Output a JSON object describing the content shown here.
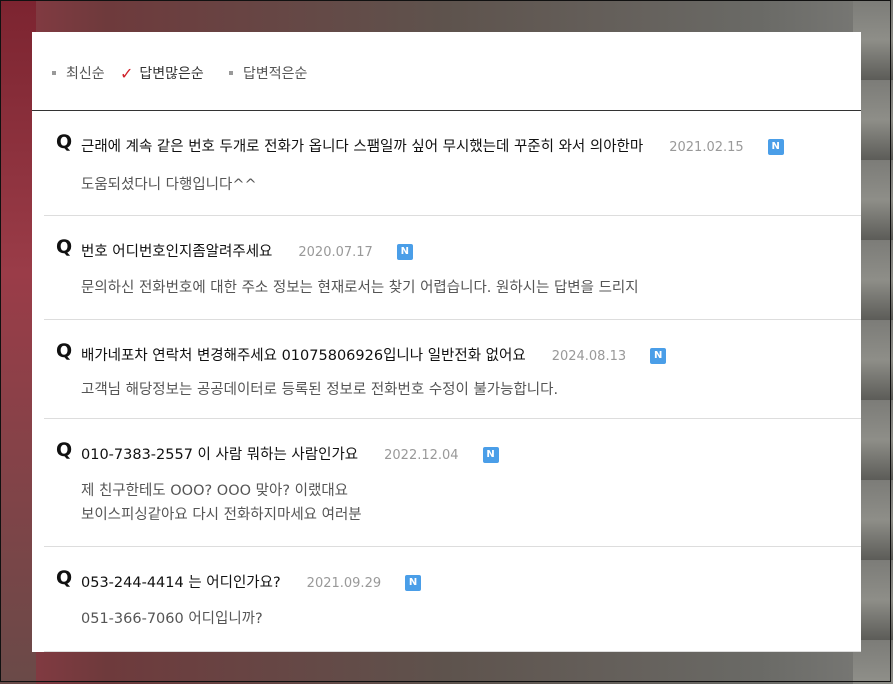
{
  "sort": {
    "items": [
      {
        "label": "최신순",
        "active": false
      },
      {
        "label": "답변많은순",
        "active": true
      },
      {
        "label": "답변적은순",
        "active": false
      }
    ]
  },
  "questions": [
    {
      "q": "Q",
      "title": "근래에 계속 같은 번호 두개로 전화가 옵니다 스팸일까 싶어 무시했는데 꾸준히 와서 의아한마",
      "date": "2021.02.15",
      "badge": "N",
      "answer": [
        "도움되셨다니 다행입니다^^"
      ]
    },
    {
      "q": "Q",
      "title": "번호 어디번호인지좀알려주세요",
      "date": "2020.07.17",
      "badge": "N",
      "answer": [
        "문의하신 전화번호에 대한 주소 정보는 현재로서는 찾기 어렵습니다. 원하시는 답변을 드리지"
      ]
    },
    {
      "q": "Q",
      "title": "배가네포차 연락처 변경해주세요 01075806926입니나 일반전화 없어요",
      "date": "2024.08.13",
      "badge": "N",
      "answer": [
        "고객님 해당정보는 공공데이터로 등록된 정보로 전화번호 수정이 불가능합니다."
      ]
    },
    {
      "q": "Q",
      "title": "010-7383-2557 이 사람 뭐하는 사람인가요",
      "date": "2022.12.04",
      "badge": "N",
      "answer": [
        "제 친구한테도 OOO? OOO 맞아? 이랬대요",
        "보이스피싱같아요 다시 전화하지마세요 여러분"
      ]
    },
    {
      "q": "Q",
      "title": "053-244-4414 는 어디인가요?",
      "date": "2021.09.29",
      "badge": "N",
      "answer": [
        "051-366-7060 어디입니까?"
      ]
    }
  ]
}
